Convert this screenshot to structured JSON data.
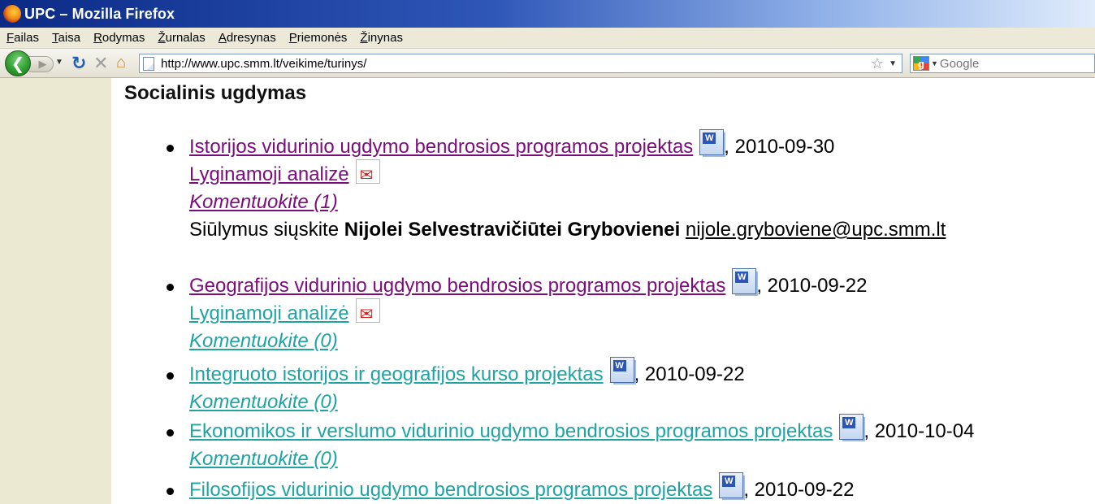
{
  "window": {
    "title": "UPC – Mozilla Firefox"
  },
  "menu": [
    {
      "accel": "F",
      "rest": "ailas"
    },
    {
      "accel": "T",
      "rest": "aisa"
    },
    {
      "accel": "R",
      "rest": "odymas"
    },
    {
      "accel": "Ž",
      "rest": "urnalas"
    },
    {
      "accel": "A",
      "rest": "dresynas"
    },
    {
      "accel": "P",
      "rest": "riemonės"
    },
    {
      "accel": "Ž",
      "rest": "inynas"
    }
  ],
  "nav": {
    "url": "http://www.upc.smm.lt/veikime/turinys/",
    "search_placeholder": "Google"
  },
  "content": {
    "heading": "Socialinis ugdymas",
    "items": [
      {
        "title": "Istorijos vidurinio ugdymo bendrosios programos projektas",
        "date": ", 2010-09-30",
        "analysis": "Lyginamoji analizė",
        "comment": "Komentuokite (1)",
        "suggest_prefix": "Siūlymus siųskite ",
        "suggest_name": "Nijolei Selvestravičiūtei Grybovienei",
        "suggest_email": "nijole.gryboviene@upc.smm.lt"
      },
      {
        "title": "Geografijos vidurinio ugdymo bendrosios programos projektas",
        "date": ", 2010-09-22",
        "analysis": "Lyginamoji analizė",
        "comment": "Komentuokite (0)"
      },
      {
        "title": "Integruoto istorijos ir geografijos kurso projektas",
        "date": ", 2010-09-22",
        "comment": "Komentuokite (0)"
      },
      {
        "title": "Ekonomikos ir verslumo vidurinio ugdymo bendrosios programos projektas",
        "date": ", 2010-10-04",
        "comment": "Komentuokite (0)"
      },
      {
        "title": "Filosofijos vidurinio ugdymo bendrosios programos projektas",
        "date": ", 2010-09-22"
      }
    ]
  }
}
